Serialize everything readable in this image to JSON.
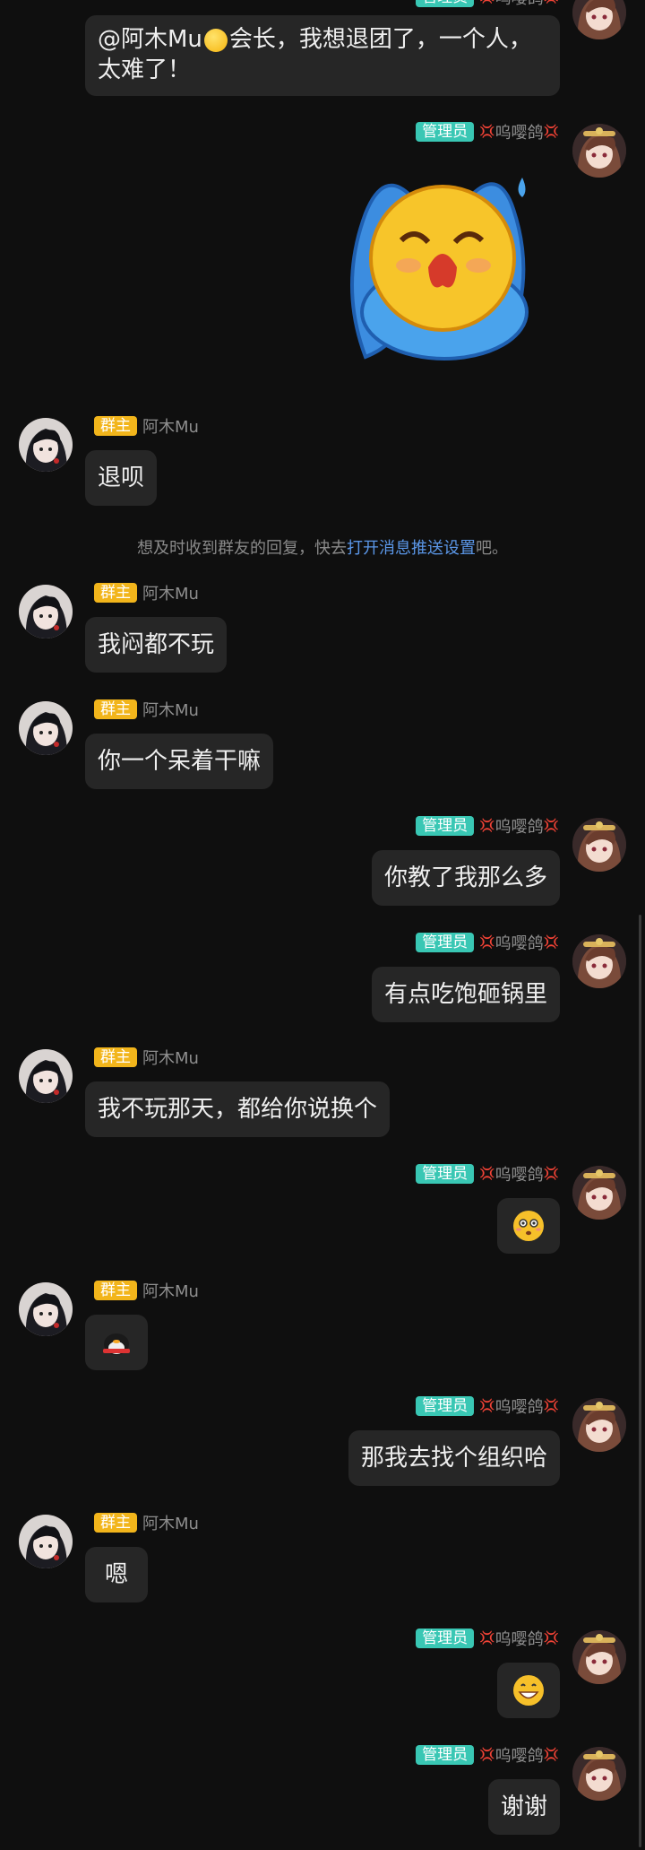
{
  "users": {
    "owner": {
      "tag": "群主",
      "name": "阿木Mu"
    },
    "admin": {
      "tag": "管理员",
      "name": "呜嘤鸽",
      "decor": "💢"
    }
  },
  "messages": [
    {
      "id": "m1",
      "text_prefix": "@阿木Mu",
      "text_suffix": "会长，我想退团了，一个人，太难了！"
    },
    {
      "id": "m2",
      "sticker": "crying-sticker"
    },
    {
      "id": "m3",
      "text": "退呗"
    },
    {
      "id": "m4",
      "text": "我闷都不玩"
    },
    {
      "id": "m5",
      "text": "你一个呆着干嘛"
    },
    {
      "id": "m6",
      "text": "你教了我那么多"
    },
    {
      "id": "m7",
      "text": "有点吃饱砸锅里"
    },
    {
      "id": "m8",
      "text": "我不玩那天，都给你说换个"
    },
    {
      "id": "m9",
      "emoji": "flushed-emoji"
    },
    {
      "id": "m10",
      "emoji": "penguin-emoji"
    },
    {
      "id": "m11",
      "text": "那我去找个组织哈"
    },
    {
      "id": "m12",
      "text": "嗯"
    },
    {
      "id": "m13",
      "emoji": "grin-emoji"
    },
    {
      "id": "m14",
      "text": "谢谢"
    }
  ],
  "notice": {
    "prefix": "想及时收到群友的回复，快去",
    "link": "打开消息推送设置",
    "suffix": "吧。"
  },
  "colors": {
    "background": "#0f0f0f",
    "bubble": "#262626",
    "owner_tag": "#f2b51b",
    "admin_tag": "#39c7b4",
    "link": "#5b97e8"
  }
}
